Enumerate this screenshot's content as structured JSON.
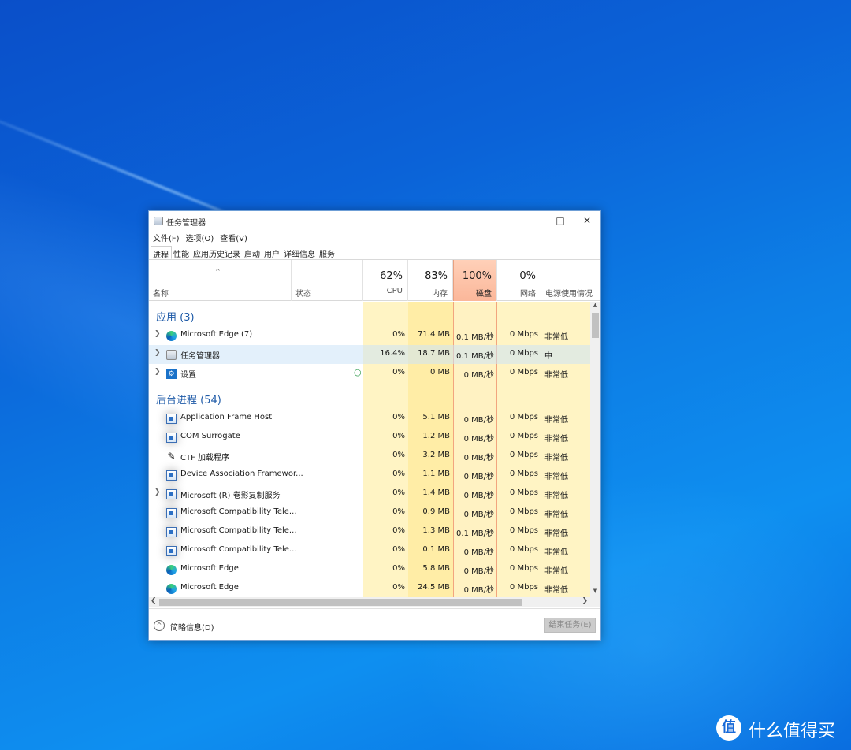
{
  "window": {
    "title": "任务管理器"
  },
  "menu": [
    "文件(F)",
    "选项(O)",
    "查看(V)"
  ],
  "tabs": [
    "进程",
    "性能",
    "应用历史记录",
    "启动",
    "用户",
    "详细信息",
    "服务"
  ],
  "columns": {
    "name": "名称",
    "status": "状态",
    "cpu": {
      "pct": "62%",
      "label": "CPU"
    },
    "mem": {
      "pct": "83%",
      "label": "内存"
    },
    "disk": {
      "pct": "100%",
      "label": "磁盘"
    },
    "net": {
      "pct": "0%",
      "label": "网络"
    },
    "power": "电源使用情况"
  },
  "groups": {
    "apps": "应用 (3)",
    "background": "后台进程 (54)"
  },
  "apps": [
    {
      "name": "Microsoft Edge (7)",
      "icon": "edge-icon",
      "cpu": "0%",
      "mem": "71.4 MB",
      "disk": "0.1 MB/秒",
      "net": "0 Mbps",
      "power": "非常低"
    },
    {
      "name": "任务管理器",
      "icon": "task-manager-icon",
      "cpu": "16.4%",
      "mem": "18.7 MB",
      "disk": "0.1 MB/秒",
      "net": "0 Mbps",
      "power": "中"
    },
    {
      "name": "设置",
      "icon": "settings-gear-icon",
      "cpu": "0%",
      "mem": "0 MB",
      "disk": "0 MB/秒",
      "net": "0 Mbps",
      "power": "非常低"
    }
  ],
  "background": [
    {
      "name": "Application Frame Host",
      "cpu": "0%",
      "mem": "5.1 MB",
      "disk": "0 MB/秒",
      "net": "0 Mbps",
      "power": "非常低"
    },
    {
      "name": "COM Surrogate",
      "cpu": "0%",
      "mem": "1.2 MB",
      "disk": "0 MB/秒",
      "net": "0 Mbps",
      "power": "非常低"
    },
    {
      "name": "CTF 加载程序",
      "cpu": "0%",
      "mem": "3.2 MB",
      "disk": "0 MB/秒",
      "net": "0 Mbps",
      "power": "非常低"
    },
    {
      "name": "Device Association Framewor...",
      "cpu": "0%",
      "mem": "1.1 MB",
      "disk": "0 MB/秒",
      "net": "0 Mbps",
      "power": "非常低"
    },
    {
      "name": "Microsoft (R) 卷影复制服务",
      "cpu": "0%",
      "mem": "1.4 MB",
      "disk": "0 MB/秒",
      "net": "0 Mbps",
      "power": "非常低"
    },
    {
      "name": "Microsoft Compatibility Tele...",
      "cpu": "0%",
      "mem": "0.9 MB",
      "disk": "0 MB/秒",
      "net": "0 Mbps",
      "power": "非常低"
    },
    {
      "name": "Microsoft Compatibility Tele...",
      "cpu": "0%",
      "mem": "1.3 MB",
      "disk": "0.1 MB/秒",
      "net": "0 Mbps",
      "power": "非常低"
    },
    {
      "name": "Microsoft Compatibility Tele...",
      "cpu": "0%",
      "mem": "0.1 MB",
      "disk": "0 MB/秒",
      "net": "0 Mbps",
      "power": "非常低"
    },
    {
      "name": "Microsoft Edge",
      "cpu": "0%",
      "mem": "5.8 MB",
      "disk": "0 MB/秒",
      "net": "0 Mbps",
      "power": "非常低"
    },
    {
      "name": "Microsoft Edge",
      "cpu": "0%",
      "mem": "24.5 MB",
      "disk": "0 MB/秒",
      "net": "0 Mbps",
      "power": "非常低"
    }
  ],
  "footer": {
    "fewer_details": "简略信息(D)",
    "end_task": "结束任务(E)"
  },
  "watermark": {
    "icon_char": "值",
    "text": "什么值得买"
  }
}
